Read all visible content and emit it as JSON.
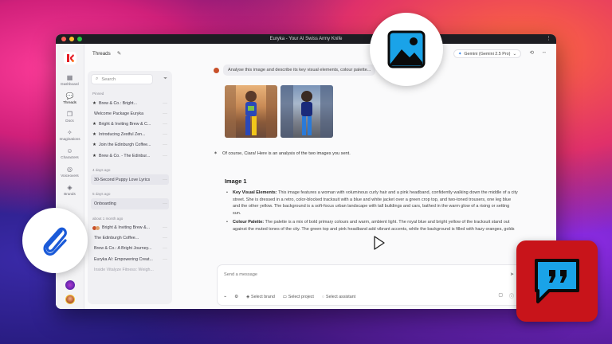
{
  "window": {
    "title": "Euryka - Your AI Swiss Army Knife"
  },
  "rail": {
    "items": [
      {
        "label": "Dashboard",
        "icon": "grid-icon"
      },
      {
        "label": "Threads",
        "icon": "chat-icon"
      },
      {
        "label": "Docs",
        "icon": "doc-icon"
      },
      {
        "label": "Imaginations",
        "icon": "sparkle-icon"
      },
      {
        "label": "Characters",
        "icon": "character-icon"
      },
      {
        "label": "Voiceovers",
        "icon": "voice-icon"
      },
      {
        "label": "Brands",
        "icon": "brand-icon"
      }
    ]
  },
  "threads": {
    "header": "Threads",
    "search_placeholder": "Search",
    "pinned_label": "Pinned",
    "pinned": [
      {
        "title": "Brew & Co.: Bright...",
        "starred": true
      },
      {
        "title": "Welcome Package Euryka",
        "starred": false
      },
      {
        "title": "Bright & Inviting Brew & C...",
        "starred": true
      },
      {
        "title": "Introducing Zestful Zen...",
        "starred": true
      },
      {
        "title": "Join the Edinburgh Coffee...",
        "starred": true
      },
      {
        "title": "Brew & Co. - The Edinbur...",
        "starred": true
      }
    ],
    "group1_label": "4 days ago",
    "group1": [
      {
        "title": "30-Second Puppy Love Lyrics"
      }
    ],
    "group2_label": "5 days ago",
    "group2": [
      {
        "title": "Onboarding"
      }
    ],
    "group3_label": "about 1 month ago",
    "group3": [
      {
        "title": "Bright & Inviting Brew &..."
      },
      {
        "title": "The Edinburgh Coffee..."
      },
      {
        "title": "Brew & Co.: A Bright Journey..."
      },
      {
        "title": "Euryka AI: Empowering Creat..."
      },
      {
        "title": "Inside Vitalyze Fitness: Weigh..."
      }
    ]
  },
  "main": {
    "model": "Gemini (Gemini 2.5 Pro)",
    "user_message": "Analyse this image and describe its key visual elements, colour palette...",
    "ai_intro": "Of course, Ciara! Here is an analysis of the two images you sent.",
    "answer": {
      "heading": "Image 1",
      "bullet1_title": "Key Visual Elements:",
      "bullet1_text": " This image features a woman with voluminous curly hair and a pink headband, confidently walking down the middle of a city street. She is dressed in a retro, color-blocked tracksuit with a blue and white jacket over a green crop top, and two-toned trousers, one leg blue and the other yellow. The background is a soft-focus urban landscape with tall buildings and cars, bathed in the warm glow of a rising or setting sun.",
      "bullet2_title": "Colour Palette:",
      "bullet2_text": " The palette is a mix of bold primary colours and warm, ambient light. The royal blue and bright yellow of the tracksuit stand out against the muted tones of the city. The green top and pink headband add vibrant accents, while the background is filled with hazy oranges, golds"
    },
    "composer": {
      "placeholder": "Send a message",
      "select_brand": "Select brand",
      "select_project": "Select project",
      "select_assistant": "Select assistant"
    }
  },
  "colors": {
    "accent": "#1aa3e8",
    "brand_red": "#c8141a"
  }
}
